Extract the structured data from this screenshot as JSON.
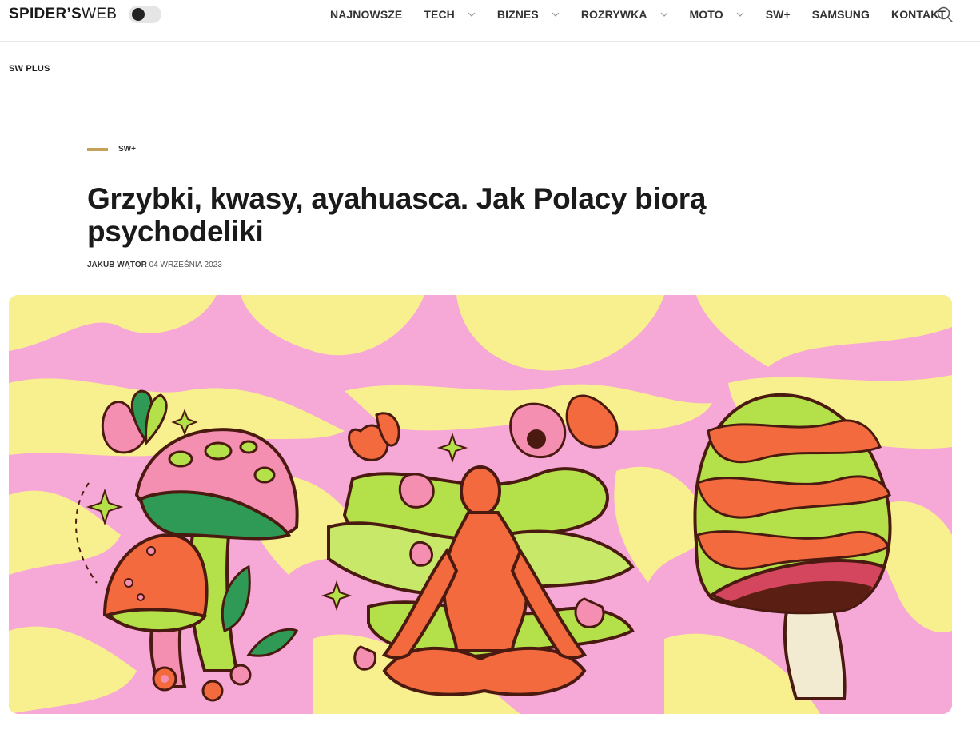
{
  "header": {
    "logo_bold": "SPIDER’S",
    "logo_thin": "WEB",
    "nav": [
      {
        "label": "NAJNOWSZE",
        "has_dropdown": false
      },
      {
        "label": "TECH",
        "has_dropdown": true
      },
      {
        "label": "BIZNES",
        "has_dropdown": true
      },
      {
        "label": "ROZRYWKA",
        "has_dropdown": true
      },
      {
        "label": "MOTO",
        "has_dropdown": true
      },
      {
        "label": "SW+",
        "has_dropdown": false
      },
      {
        "label": "SAMSUNG",
        "has_dropdown": false
      },
      {
        "label": "KONTAKT",
        "has_dropdown": false
      }
    ],
    "search_icon": "search-icon"
  },
  "subnav": {
    "active_tab": "SW PLUS"
  },
  "article": {
    "category": "SW+",
    "title": "Grzybki, kwasy, ayahuasca. Jak Polacy biorą psychodeliki",
    "author": "JAKUB WĄTOR",
    "date": "04 WRZEŚNIA 2023"
  },
  "colors": {
    "accent_gold": "#c6a15b",
    "hero_pink": "#f6a8d6",
    "hero_yellow": "#f8f08e",
    "illustration_orange": "#f26a3d",
    "illustration_green": "#b4e04a",
    "outline": "#4a1a10"
  }
}
